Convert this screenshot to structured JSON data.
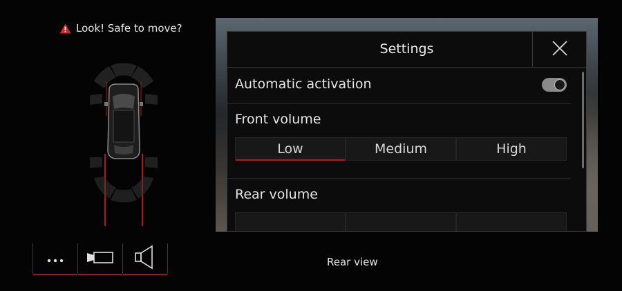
{
  "warning": {
    "text": "Look! Safe to move?",
    "icon": "warning-triangle-icon",
    "icon_color": "#d8232a"
  },
  "settings": {
    "title": "Settings",
    "close_icon": "close-icon",
    "automatic_activation": {
      "label": "Automatic activation",
      "enabled": true
    },
    "front_volume": {
      "label": "Front volume",
      "options": [
        "Low",
        "Medium",
        "High"
      ],
      "selected": "Low"
    },
    "rear_volume": {
      "label": "Rear volume"
    }
  },
  "bottom_bar": {
    "buttons": [
      {
        "icon": "more-dots-icon"
      },
      {
        "icon": "camera-icon"
      },
      {
        "icon": "speaker-icon"
      }
    ]
  },
  "footer": {
    "label": "Rear view"
  },
  "colors": {
    "accent_red": "#c0141c",
    "background": "#040404"
  }
}
